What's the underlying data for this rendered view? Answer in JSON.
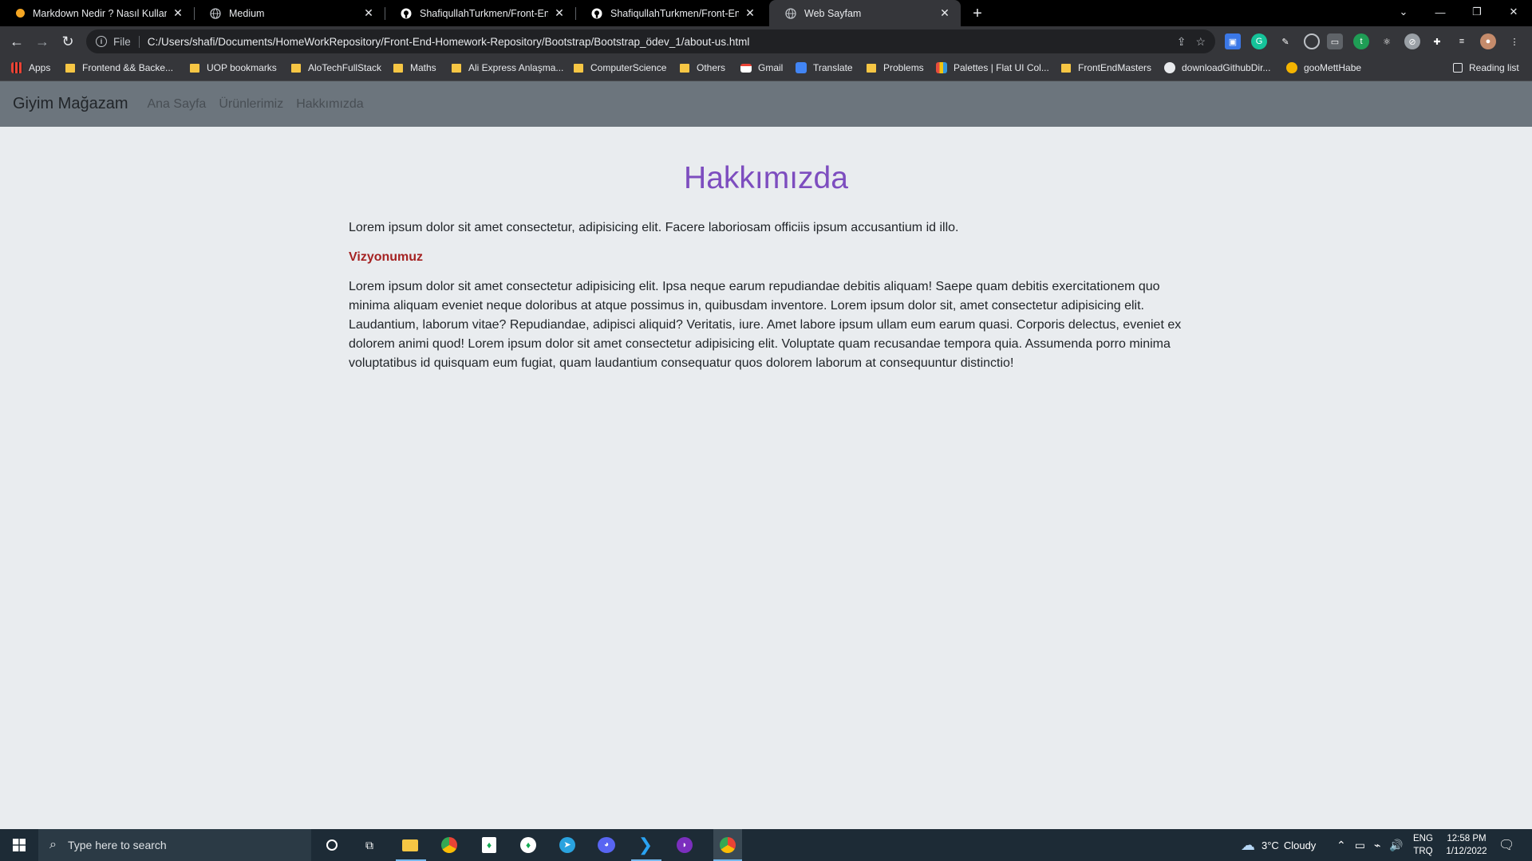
{
  "browser": {
    "tabs": [
      {
        "title": "Markdown Nedir ? Nasıl Kullanılır",
        "icon": "medium-dot-icon",
        "active": false
      },
      {
        "title": "Medium",
        "icon": "globe-icon",
        "active": false
      },
      {
        "title": "ShafiqullahTurkmen/Front-End-H",
        "icon": "github-icon",
        "active": false
      },
      {
        "title": "ShafiqullahTurkmen/Front-End-H",
        "icon": "github-icon",
        "active": false
      },
      {
        "title": "Web Sayfam",
        "icon": "globe-icon",
        "active": true
      }
    ],
    "address": {
      "scheme": "File",
      "url": "C:/Users/shafi/Documents/HomeWorkRepository/Front-End-Homework-Repository/Bootstrap/Bootstrap_ödev_1/about-us.html"
    },
    "bookmarks": [
      {
        "label": "Apps",
        "icon": "apps-grid-icon"
      },
      {
        "label": "Frontend && Backe...",
        "icon": "folder-icon"
      },
      {
        "label": "UOP bookmarks",
        "icon": "folder-icon"
      },
      {
        "label": "AloTechFullStack",
        "icon": "folder-icon"
      },
      {
        "label": "Maths",
        "icon": "folder-icon"
      },
      {
        "label": "Ali Express Anlaşma...",
        "icon": "folder-icon"
      },
      {
        "label": "ComputerScience",
        "icon": "folder-icon"
      },
      {
        "label": "Others",
        "icon": "folder-icon"
      },
      {
        "label": "Gmail",
        "icon": "gmail-icon"
      },
      {
        "label": "Translate",
        "icon": "translate-icon"
      },
      {
        "label": "Problems",
        "icon": "folder-icon"
      },
      {
        "label": "Palettes | Flat UI Col...",
        "icon": "palette-icon"
      },
      {
        "label": "FrontEndMasters",
        "icon": "folder-icon"
      },
      {
        "label": "downloadGithubDir...",
        "icon": "globe-icon"
      },
      {
        "label": "gooMettHabe",
        "icon": "goomett-icon"
      }
    ],
    "reading_list": "Reading list"
  },
  "page": {
    "navbar": {
      "brand": "Giyim Mağazam",
      "links": [
        "Ana Sayfa",
        "Ürünlerimiz",
        "Hakkımızda"
      ]
    },
    "heading": "Hakkımızda",
    "intro": "Lorem ipsum dolor sit amet consectetur, adipisicing elit. Facere laboriosam officiis ipsum accusantium id illo.",
    "vision_heading": "Vizyonumuz",
    "vision_text": "Lorem ipsum dolor sit amet consectetur adipisicing elit. Ipsa neque earum repudiandae debitis aliquam! Saepe quam debitis exercitationem quo minima aliquam eveniet neque doloribus at atque possimus in, quibusdam inventore. Lorem ipsum dolor sit, amet consectetur adipisicing elit. Laudantium, laborum vitae? Repudiandae, adipisci aliquid? Veritatis, iure. Amet labore ipsum ullam eum earum quasi. Corporis delectus, eveniet ex dolorem animi quod! Lorem ipsum dolor sit amet consectetur adipisicing elit. Voluptate quam recusandae tempora quia. Assumenda porro minima voluptatibus id quisquam eum fugiat, quam laudantium consequatur quos dolorem laborum at consequuntur distinctio!"
  },
  "taskbar": {
    "search_placeholder": "Type here to search",
    "weather": {
      "temp": "3°C",
      "condition": "Cloudy"
    },
    "lang": {
      "primary": "ENG",
      "secondary": "TRQ"
    },
    "time": "12:58 PM",
    "date": "1/12/2022"
  },
  "colors": {
    "heading": "#7d4dbf",
    "vision": "#a52323",
    "navbar": "#6c757d",
    "page_bg": "#e9ecef"
  }
}
